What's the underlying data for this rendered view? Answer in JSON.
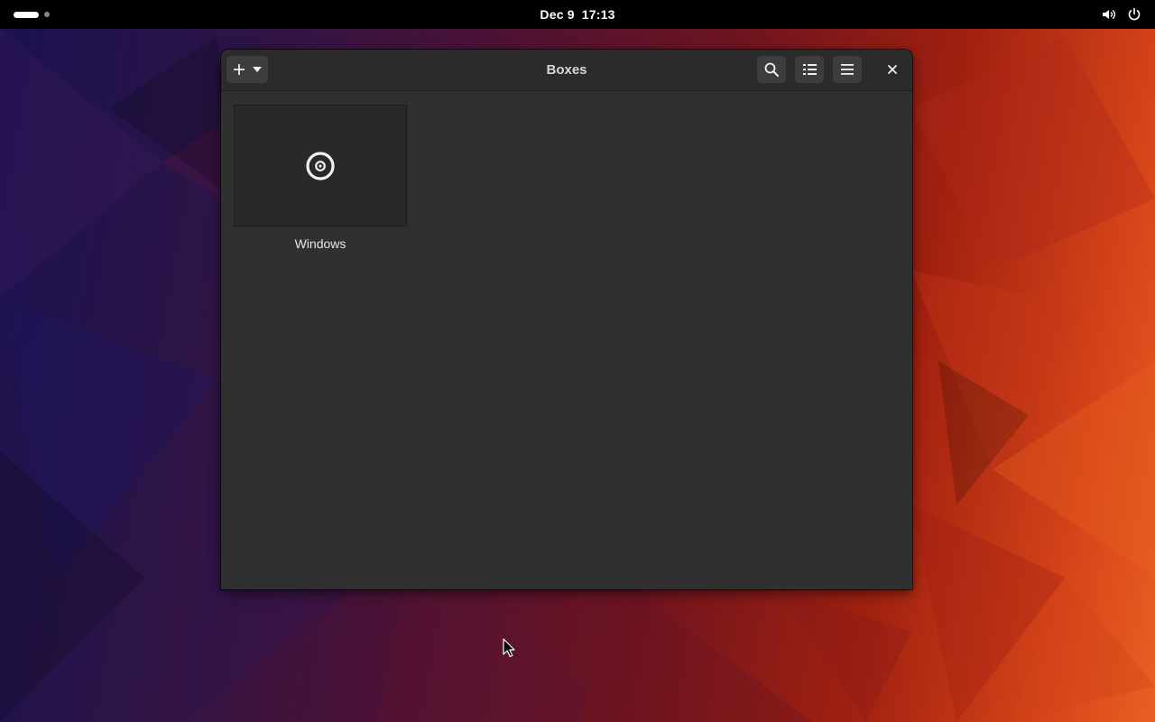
{
  "topbar": {
    "date": "Dec 9",
    "time": "17:13",
    "activities_icon": "workspace-indicator-icon",
    "volume_icon": "volume-icon",
    "power_icon": "power-icon"
  },
  "window": {
    "title": "Boxes",
    "add_icon": "plus-icon",
    "add_dropdown_icon": "chevron-down-icon",
    "search_icon": "search-icon",
    "view_toggle_icon": "list-view-icon",
    "menu_icon": "hamburger-menu-icon",
    "close_icon": "close-icon"
  },
  "boxes": [
    {
      "name": "Windows",
      "icon": "disc-icon"
    }
  ],
  "colors": {
    "topbar": "#000000",
    "window_bg": "#303030",
    "headerbar_bg": "#2b2b2b",
    "button_bg": "#3d3d3d"
  }
}
